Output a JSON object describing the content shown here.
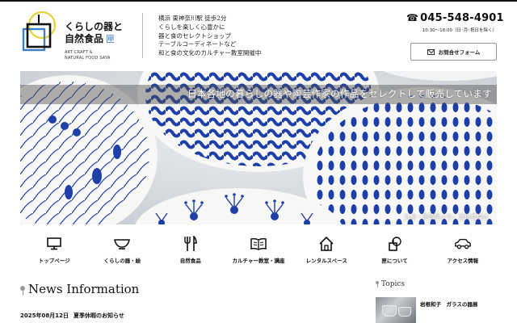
{
  "header": {
    "logo": {
      "title_line1": "くらしの器と",
      "title_line2": "自然食品",
      "title_hand": "匣",
      "sub_line1": "ART CRAFT &",
      "sub_line2": "NATURAL FOOD SAYA"
    },
    "tagline": [
      "横浜 東神奈川駅 徒歩2分",
      "くらしを楽しく心豊かに",
      "器と食のセレクトショップ",
      "テーブルコーディネートなど",
      "和と食の文化のカルチャー教室開催中"
    ],
    "phone": "045-548-4901",
    "hours": "10:30〜18:00（日･月･祝日を除く）",
    "contact_button": "お問合せフォーム"
  },
  "hero": {
    "caption": "日本各地の暮らしの器や陶芸作家の作品をセレクトして販売しています",
    "credit": "九州・長崎県より」波佐見焼き",
    "colors": {
      "indigo": "#1e3fa8",
      "white": "#f7f7f5"
    }
  },
  "nav": {
    "items": [
      {
        "label": "トップページ",
        "icon": "monitor-icon"
      },
      {
        "label": "くらしの器・絵",
        "icon": "bowl-icon"
      },
      {
        "label": "自然食品",
        "icon": "utensils-icon"
      },
      {
        "label": "カルチャー教室・講座",
        "icon": "book-icon"
      },
      {
        "label": "レンタルスペース",
        "icon": "house-icon"
      },
      {
        "label": "匣について",
        "icon": "info-icon"
      },
      {
        "label": "アクセス情報",
        "icon": "car-icon"
      }
    ]
  },
  "news": {
    "title": "News Information",
    "items": [
      {
        "date": "2025年08月12日",
        "text": "夏季休暇のお知らせ"
      }
    ]
  },
  "topics": {
    "title": "Topics",
    "items": [
      {
        "text": "岩根和子　ガラスの器展"
      }
    ]
  }
}
